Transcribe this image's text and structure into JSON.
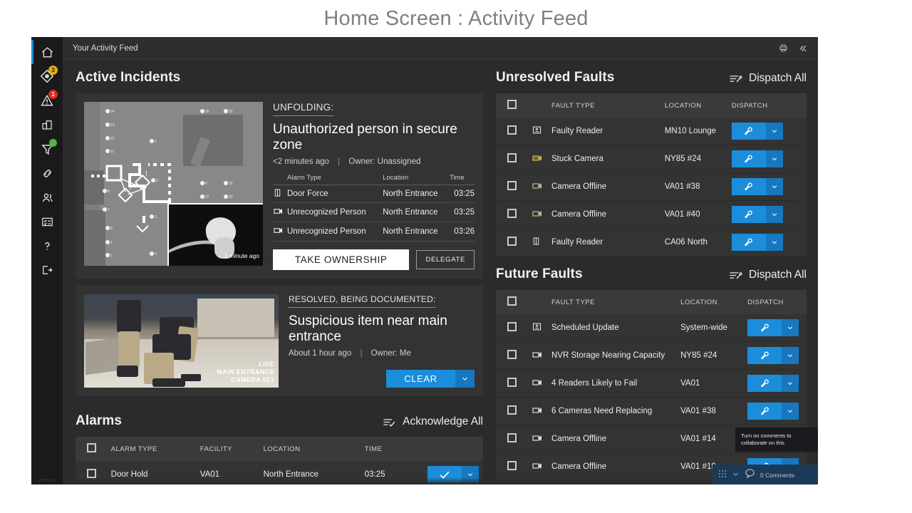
{
  "slide": {
    "title": "Home Screen : Activity Feed"
  },
  "topbar": {
    "title": "Your Activity Feed",
    "print_icon": "printer-icon",
    "collapse_icon": "double-chevron-left-icon"
  },
  "sidebar": {
    "footer_text": "version",
    "items": [
      {
        "name": "home",
        "icon": "home-icon",
        "badge": null,
        "dot": false,
        "active": true
      },
      {
        "name": "incidents",
        "icon": "diamond-eye-icon",
        "badge": "3",
        "badge_color": "amber",
        "dot": false,
        "active": false
      },
      {
        "name": "alarms",
        "icon": "warning-triangle-icon",
        "badge": "1",
        "badge_color": "red",
        "dot": false,
        "active": false
      },
      {
        "name": "facilities",
        "icon": "building-icon",
        "badge": null,
        "dot": false,
        "active": false
      },
      {
        "name": "filters",
        "icon": "funnel-icon",
        "badge": null,
        "dot": true,
        "active": false
      },
      {
        "name": "links",
        "icon": "link-icon",
        "badge": null,
        "dot": false,
        "active": false
      },
      {
        "name": "people",
        "icon": "people-icon",
        "badge": null,
        "dot": false,
        "active": false
      },
      {
        "name": "reports",
        "icon": "checklist-icon",
        "badge": null,
        "dot": false,
        "active": false
      },
      {
        "name": "help",
        "icon": "question-mark-icon",
        "badge": null,
        "dot": false,
        "active": false
      },
      {
        "name": "logout",
        "icon": "logout-icon",
        "badge": null,
        "dot": false,
        "active": false
      }
    ]
  },
  "active_incidents": {
    "section_title": "Active Incidents",
    "incident1": {
      "status": "UNFOLDING:",
      "title": "Unauthorized person in secure zone",
      "time_ago": "<2 minutes ago",
      "owner": "Owner: Unassigned",
      "floorplan_timestamp": "1 minute ago",
      "table_headers": {
        "type": "Alarm Type",
        "location": "Location",
        "time": "Time"
      },
      "rows": [
        {
          "icon": "door-icon",
          "type": "Door Force",
          "location": "North Entrance",
          "time": "03:25"
        },
        {
          "icon": "camera-icon",
          "type": "Unrecognized Person",
          "location": "North Entrance",
          "time": "03:25"
        },
        {
          "icon": "camera-icon",
          "type": "Unrecognized Person",
          "location": "North Entrance",
          "time": "03:26"
        }
      ],
      "take_ownership_label": "TAKE OWNERSHIP",
      "delegate_label": "DELEGATE"
    },
    "incident2": {
      "status": "RESOLVED, BEING DOCUMENTED:",
      "title": "Suspicious item near main entrance",
      "time_ago": "About 1 hour ago",
      "owner": "Owner: Me",
      "video_overlay": "LIVE\nMAIN ENTRANCE\nCAMERA 021",
      "video_line1": "LIVE",
      "video_line2": "MAIN ENTRANCE",
      "video_line3": "CAMERA 021",
      "clear_label": "CLEAR"
    }
  },
  "alarms": {
    "section_title": "Alarms",
    "action_label": "Acknowledge All",
    "action_icon": "lines-check-icon",
    "headers": [
      "",
      "ALARM TYPE",
      "FACILITY",
      "LOCATION",
      "TIME",
      ""
    ],
    "rows": [
      {
        "type": "Door Hold",
        "facility": "VA01",
        "location": "North Entrance",
        "time": "03:25",
        "action_icon": "check-icon"
      }
    ]
  },
  "unresolved_faults": {
    "section_title": "Unresolved Faults",
    "action_label": "Dispatch All",
    "action_icon": "lines-wrench-icon",
    "headers": [
      "",
      "",
      "FAULT TYPE",
      "LOCATION",
      "DISPATCH"
    ],
    "rows": [
      {
        "icon": "card-reader-icon",
        "icon_color": "#e8e8e8",
        "type": "Faulty Reader",
        "location": "MN10 Lounge"
      },
      {
        "icon": "camera-icon",
        "icon_color": "#d6b24e",
        "type": "Stuck Camera",
        "location": "NY85 #24"
      },
      {
        "icon": "camera-icon",
        "icon_color": "#c8ba92",
        "type": "Camera Offline",
        "location": "VA01 #38"
      },
      {
        "icon": "camera-icon",
        "icon_color": "#c8ba92",
        "type": "Camera Offline",
        "location": "VA01 #40"
      },
      {
        "icon": "door-icon",
        "icon_color": "#e8e8e8",
        "type": "Faulty Reader",
        "location": "CA06 North"
      }
    ]
  },
  "future_faults": {
    "section_title": "Future Faults",
    "action_label": "Dispatch All",
    "action_icon": "lines-wrench-icon",
    "headers": [
      "",
      "",
      "FAULT TYPE",
      "LOCATION",
      "DISPATCH"
    ],
    "rows": [
      {
        "icon": "card-reader-icon",
        "type": "Scheduled Update",
        "location": "System-wide"
      },
      {
        "icon": "camera-icon",
        "type": "NVR Storage Nearing Capacity",
        "location": "NY85 #24"
      },
      {
        "icon": "camera-icon",
        "type": "4 Readers Likely to Fail",
        "location": "VA01"
      },
      {
        "icon": "camera-icon",
        "type": "6 Cameras Need Replacing",
        "location": "VA01 #38"
      },
      {
        "icon": "camera-icon",
        "type": "Camera Offline",
        "location": "VA01 #14"
      },
      {
        "icon": "camera-icon",
        "type": "Camera Offline",
        "location": "VA01 #19"
      }
    ]
  },
  "comment_overlay": {
    "tooltip_line1": "Turn on comments to",
    "tooltip_line2": "collaborate on this",
    "count_label": "0 Comments"
  },
  "colors": {
    "accent_blue": "#1b8ddb",
    "accent_blue_dark": "#1778bf",
    "panel": "#333333",
    "page_bg": "#2b2b2b",
    "header_row": "#3a3a3a",
    "badge_amber": "#e8ab17",
    "badge_red": "#e02b1f",
    "status_green": "#51b548"
  }
}
